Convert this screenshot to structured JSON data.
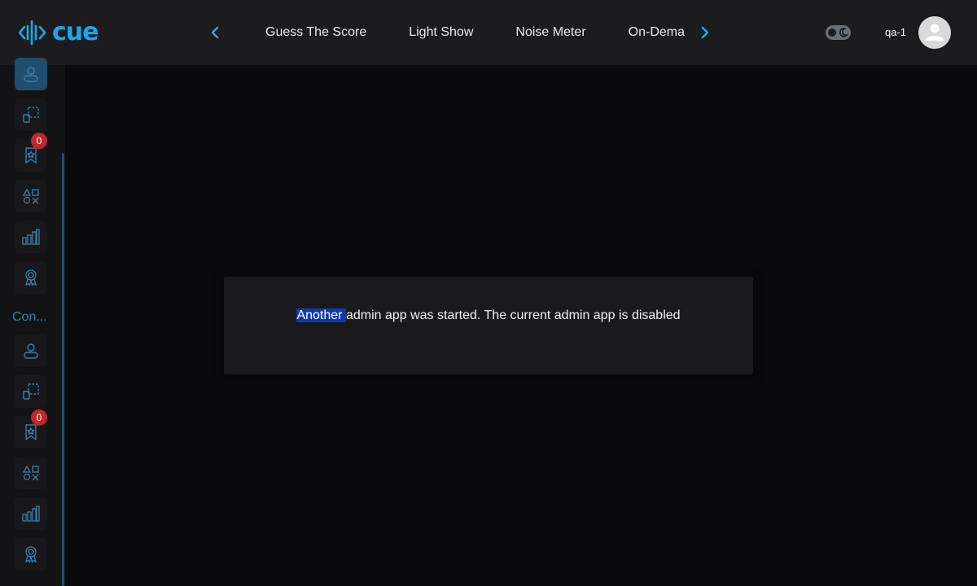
{
  "brand": {
    "logo_text": "cue",
    "accent_color": "#1aa7ec"
  },
  "header": {
    "tabs": [
      {
        "label": "Guess The Score"
      },
      {
        "label": "Light Show"
      },
      {
        "label": "Noise Meter"
      },
      {
        "label": "On-Demand"
      }
    ],
    "prev_icon": "chevron-left-icon",
    "next_icon": "chevron-right-icon",
    "theme_toggle": {
      "icon": "moon-icon",
      "state": "dark"
    },
    "user": {
      "name": "qa-1",
      "avatar_icon": "user-icon"
    }
  },
  "sidebar": {
    "group1": [
      {
        "icon": "user-icon",
        "active": true
      },
      {
        "icon": "layout-icon"
      },
      {
        "icon": "bookmark-star-icon",
        "badge": "0"
      },
      {
        "icon": "shapes-icon"
      },
      {
        "icon": "bar-chart-icon"
      },
      {
        "icon": "award-icon"
      }
    ],
    "section_label": "Con...",
    "group2": [
      {
        "icon": "user-icon"
      },
      {
        "icon": "layout-icon"
      },
      {
        "icon": "bookmark-star-icon",
        "badge": "0"
      },
      {
        "icon": "shapes-icon"
      },
      {
        "icon": "bar-chart-icon"
      },
      {
        "icon": "award-icon"
      }
    ]
  },
  "dialog": {
    "message_selected": "Another ",
    "message_rest": "admin app was started. The current admin app is disabled"
  }
}
